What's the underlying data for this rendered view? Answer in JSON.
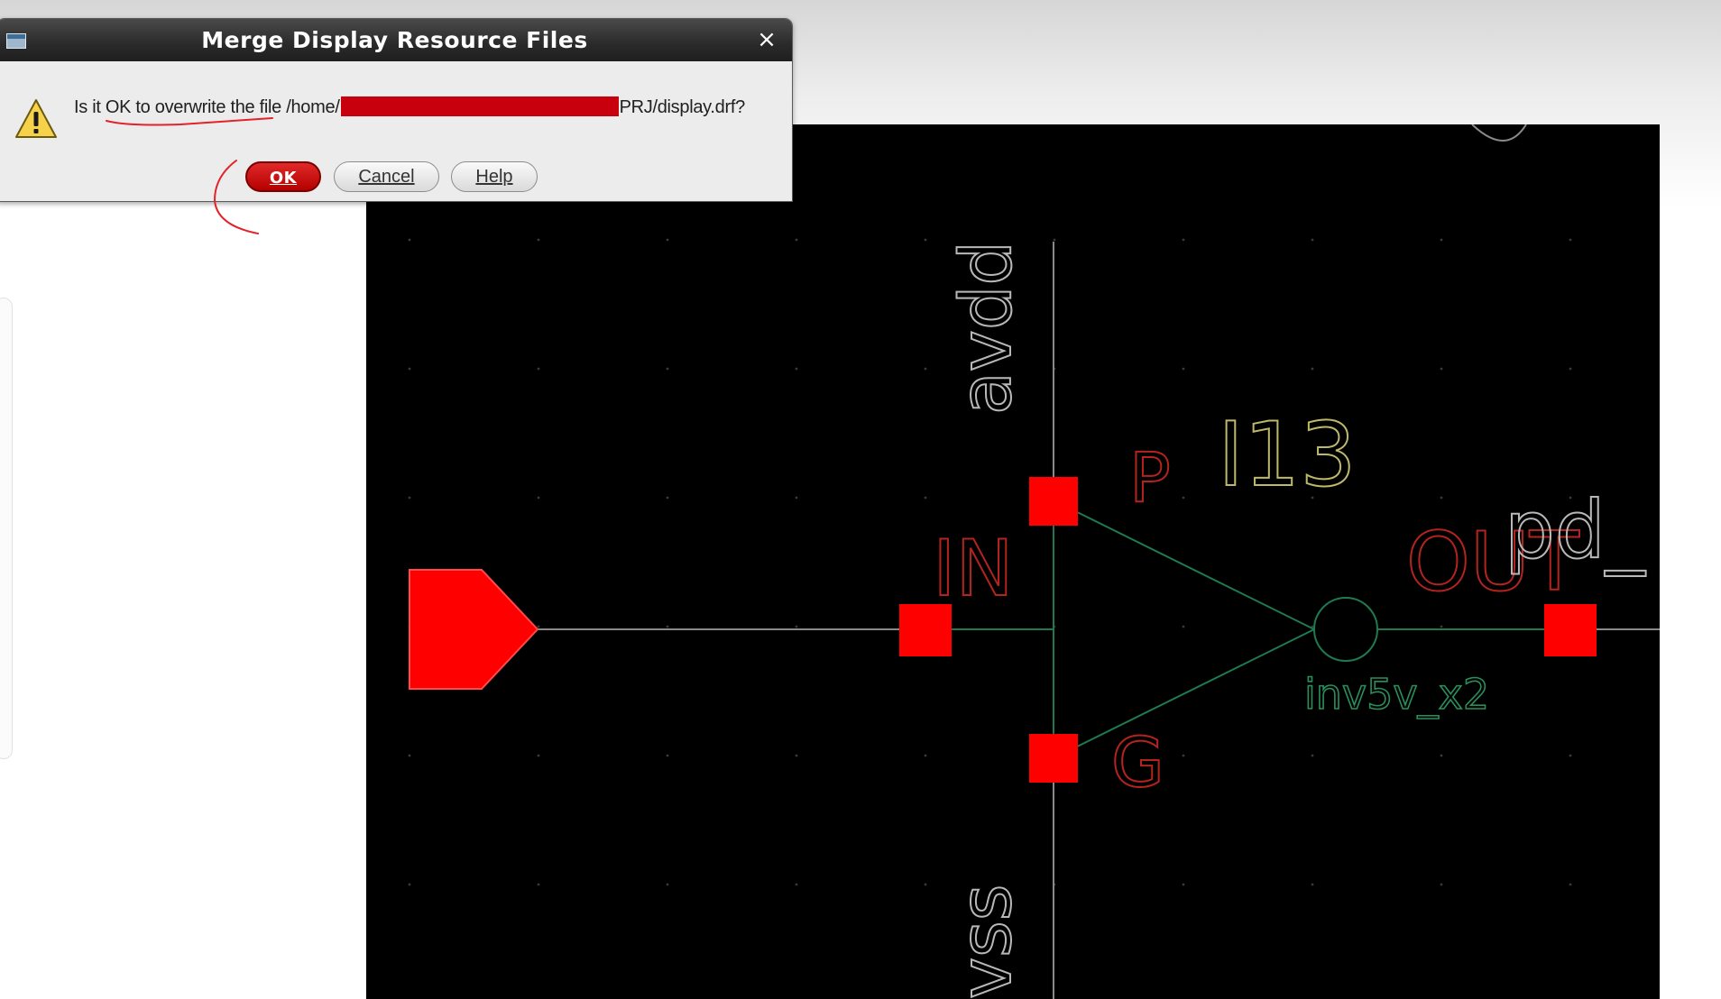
{
  "dialog": {
    "title": "Merge Display Resource Files",
    "close_glyph": "×",
    "message_prefix": "Is it OK to overwrite the file /home/",
    "message_suffix": "PRJ/display.drf?",
    "buttons": {
      "ok": "OK",
      "cancel": "Cancel",
      "help": "Help"
    },
    "icon": "warning-icon"
  },
  "schematic": {
    "labels": {
      "net_top": "avdd",
      "net_bottom": "vss",
      "instance": "I13",
      "pin_p": "P",
      "pin_g": "G",
      "pin_in": "IN",
      "pin_out": "OUT",
      "cell": "inv5v_x2",
      "net_right": "pd_"
    },
    "colors": {
      "background": "#000000",
      "wire": "#1f7a4f",
      "pin": "#ff0000",
      "pin_label": "#b3241e",
      "net_label": "#b8b8b8",
      "instance_label": "#bdb86a",
      "cell_label": "#2a8f5a"
    }
  },
  "annotation_color": "#e3222a"
}
